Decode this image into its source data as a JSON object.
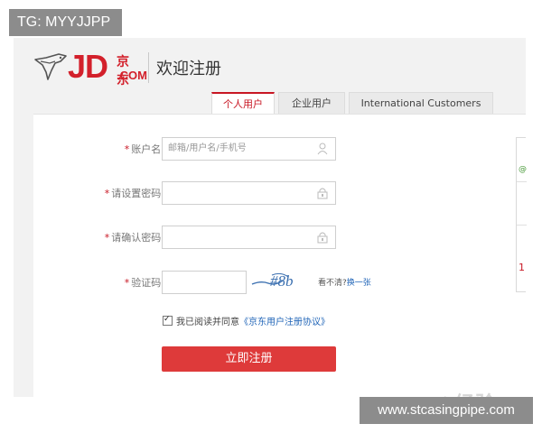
{
  "overlay": {
    "tag": "TG: MYYJJPP",
    "watermark": "www.stcasingpipe.com"
  },
  "header": {
    "logo_text": "JD",
    "logo_cn": "京东",
    "logo_com": ".COM",
    "title": "欢迎注册"
  },
  "tabs": [
    {
      "label": "个人用户",
      "active": true
    },
    {
      "label": "企业用户",
      "active": false
    },
    {
      "label": "International Customers",
      "active": false
    }
  ],
  "form": {
    "username": {
      "label": "账户名:",
      "placeholder": "邮箱/用户名/手机号",
      "value": ""
    },
    "password": {
      "label": "请设置密码:",
      "value": ""
    },
    "confirm_password": {
      "label": "请确认密码:",
      "value": ""
    },
    "captcha": {
      "label": "验证码:",
      "value": "",
      "image_text": "#8b",
      "hint": "看不清?",
      "refresh": "换一张"
    },
    "required_mark": "*",
    "agreement": {
      "checked": true,
      "text": "我已阅读并同意",
      "link": "《京东用户注册协议》"
    },
    "submit_label": "立即注册"
  },
  "side_panel": {
    "top_mark": "@",
    "bottom_mark": "1"
  },
  "faint_watermark": "Bai 经验",
  "colors": {
    "brand_red": "#d3202b",
    "submit_red": "#de3a3a",
    "link_blue": "#2266b8"
  }
}
